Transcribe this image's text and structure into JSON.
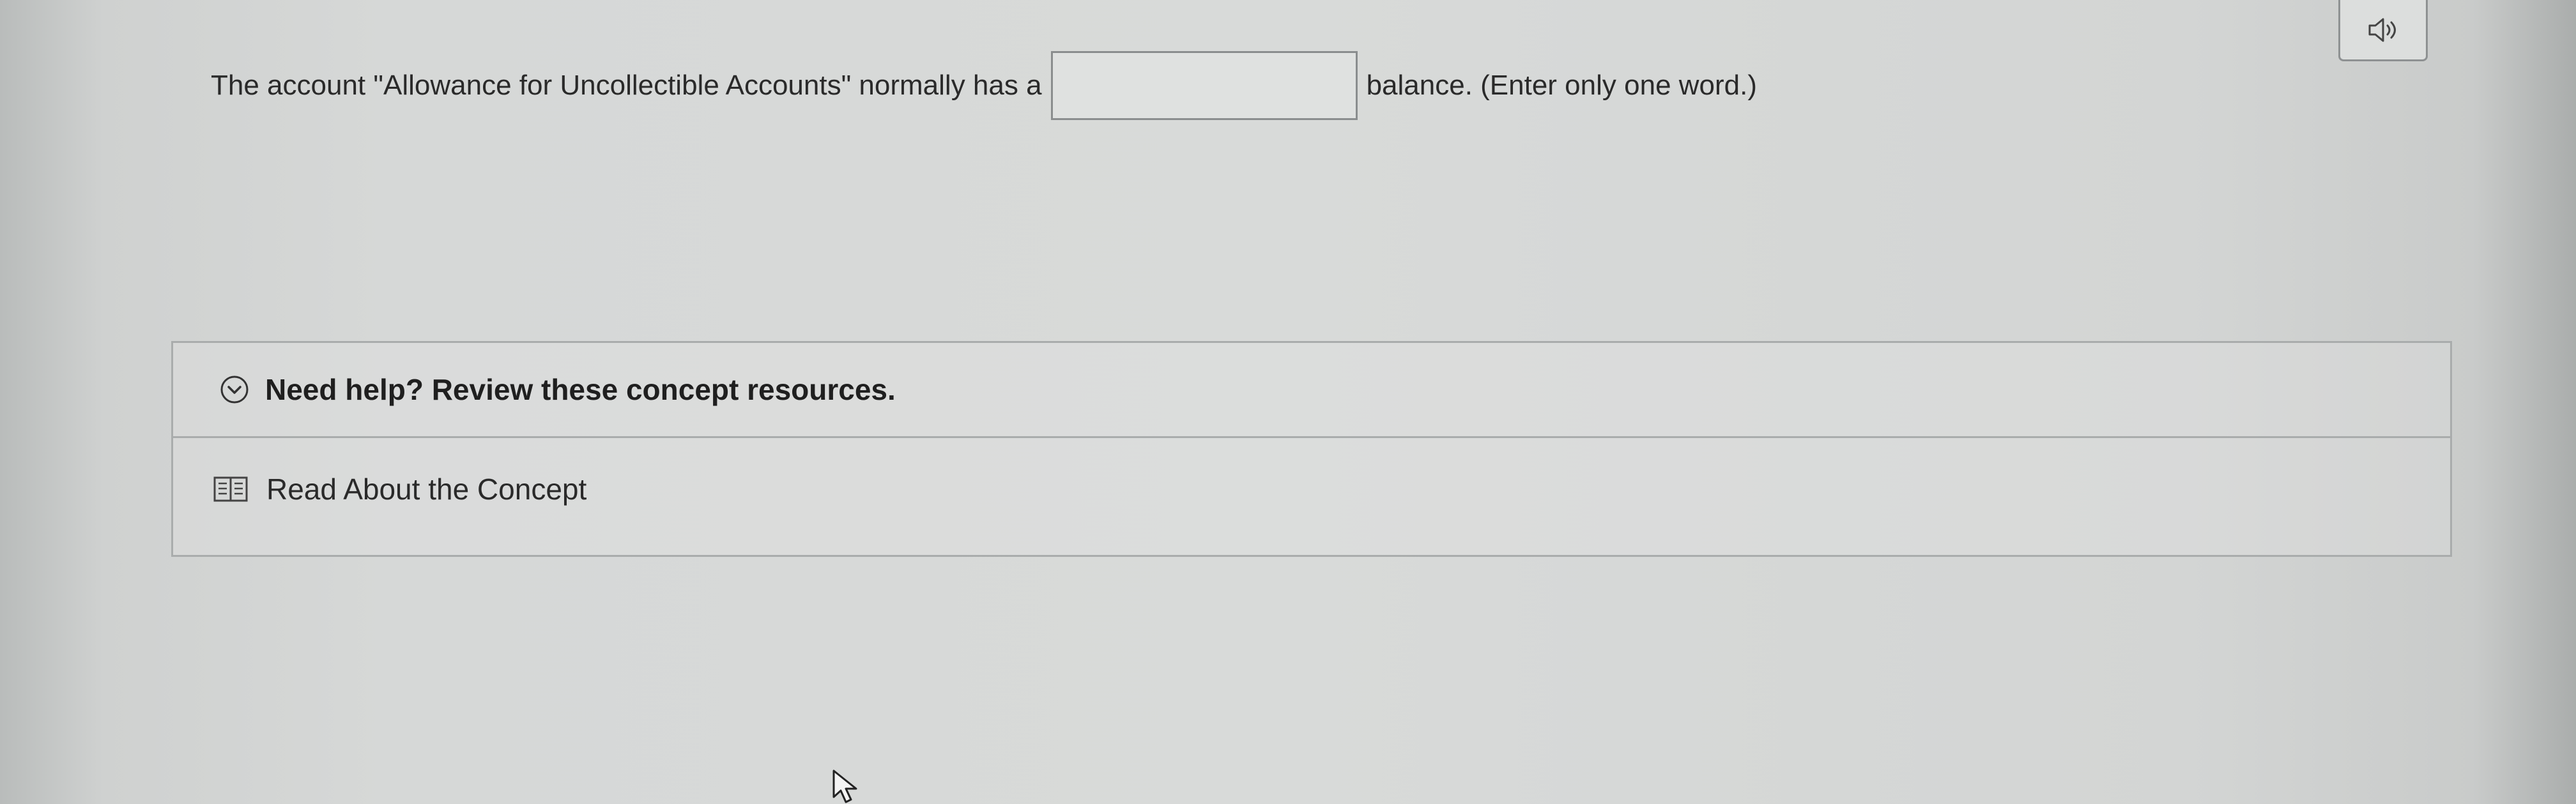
{
  "question": {
    "prefix": "The account \"Allowance for Uncollectible Accounts\" normally has a",
    "answer_value": "",
    "suffix": "balance. (Enter only one word.)"
  },
  "help": {
    "title": "Need help? Review these concept resources.",
    "resources": [
      {
        "label": "Read About the Concept",
        "icon": "book-icon"
      }
    ]
  },
  "icons": {
    "audio": "speaker-icon",
    "toggle": "chevron-down-circle-icon",
    "cursor": "mouse-pointer-icon"
  }
}
